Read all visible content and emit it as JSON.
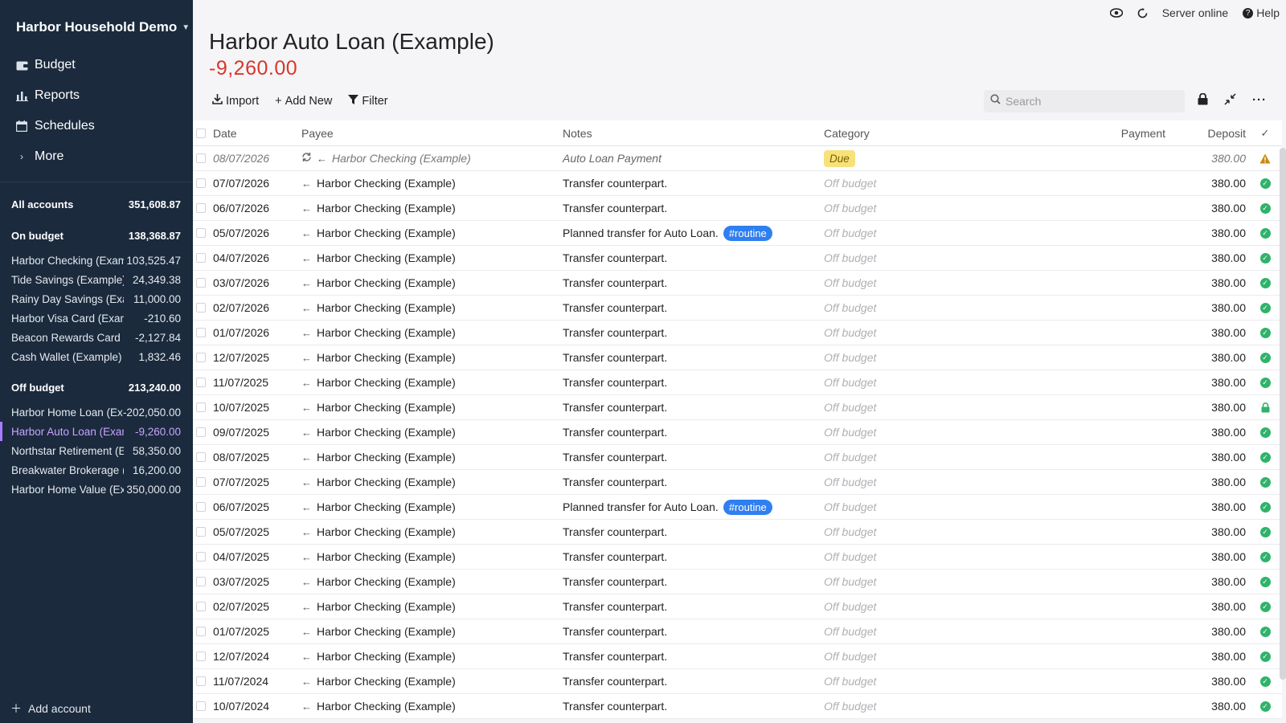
{
  "sidebar": {
    "budget_name": "Harbor Household Demo",
    "nav": [
      {
        "label": "Budget",
        "icon": "wallet-icon"
      },
      {
        "label": "Reports",
        "icon": "bar-chart-icon"
      },
      {
        "label": "Schedules",
        "icon": "calendar-icon"
      },
      {
        "label": "More",
        "icon": "chevron-right-icon"
      }
    ],
    "all_accounts": {
      "label": "All accounts",
      "balance": "351,608.87"
    },
    "on_budget": {
      "label": "On budget",
      "balance": "138,368.87"
    },
    "on_budget_accounts": [
      {
        "name": "Harbor Checking (Example)",
        "balance": "103,525.47"
      },
      {
        "name": "Tide Savings (Example)",
        "balance": "24,349.38"
      },
      {
        "name": "Rainy Day Savings (Example)",
        "balance": "11,000.00"
      },
      {
        "name": "Harbor Visa Card (Example)",
        "balance": "-210.60"
      },
      {
        "name": "Beacon Rewards Card (Example)",
        "balance": "-2,127.84"
      },
      {
        "name": "Cash Wallet (Example)",
        "balance": "1,832.46"
      }
    ],
    "off_budget": {
      "label": "Off budget",
      "balance": "213,240.00"
    },
    "off_budget_accounts": [
      {
        "name": "Harbor Home Loan (Example)",
        "balance": "-202,050.00"
      },
      {
        "name": "Harbor Auto Loan (Example)",
        "balance": "-9,260.00",
        "selected": true
      },
      {
        "name": "Northstar Retirement (Example)",
        "balance": "58,350.00"
      },
      {
        "name": "Breakwater Brokerage (Example)",
        "balance": "16,200.00"
      },
      {
        "name": "Harbor Home Value (Example)",
        "balance": "350,000.00"
      }
    ],
    "add_account": "Add account"
  },
  "topbar": {
    "server_status": "Server online",
    "help": "Help"
  },
  "account": {
    "title": "Harbor Auto Loan (Example)",
    "balance": "-9,260.00"
  },
  "toolbar": {
    "import": "Import",
    "add_new": "Add New",
    "filter": "Filter",
    "search_placeholder": "Search"
  },
  "columns": {
    "date": "Date",
    "payee": "Payee",
    "notes": "Notes",
    "category": "Category",
    "payment": "Payment",
    "deposit": "Deposit"
  },
  "colors": {
    "sidebar_bg": "#1b2a3d",
    "negative": "#d9362b",
    "selected_account": "#c8a5ff",
    "tag": "#2f7ff0",
    "cleared": "#2fb36a"
  },
  "transactions": [
    {
      "date": "08/07/2026",
      "payee": "Harbor Checking (Example)",
      "notes": "Auto Loan Payment",
      "tag": "",
      "category": "Due",
      "payment": "",
      "deposit": "380.00",
      "status": "warning",
      "scheduled": true
    },
    {
      "date": "07/07/2026",
      "payee": "Harbor Checking (Example)",
      "notes": "Transfer counterpart.",
      "tag": "",
      "category": "Off budget",
      "payment": "",
      "deposit": "380.00",
      "status": "cleared"
    },
    {
      "date": "06/07/2026",
      "payee": "Harbor Checking (Example)",
      "notes": "Transfer counterpart.",
      "tag": "",
      "category": "Off budget",
      "payment": "",
      "deposit": "380.00",
      "status": "cleared"
    },
    {
      "date": "05/07/2026",
      "payee": "Harbor Checking (Example)",
      "notes": "Planned transfer for Auto Loan.",
      "tag": "#routine",
      "category": "Off budget",
      "payment": "",
      "deposit": "380.00",
      "status": "cleared"
    },
    {
      "date": "04/07/2026",
      "payee": "Harbor Checking (Example)",
      "notes": "Transfer counterpart.",
      "tag": "",
      "category": "Off budget",
      "payment": "",
      "deposit": "380.00",
      "status": "cleared"
    },
    {
      "date": "03/07/2026",
      "payee": "Harbor Checking (Example)",
      "notes": "Transfer counterpart.",
      "tag": "",
      "category": "Off budget",
      "payment": "",
      "deposit": "380.00",
      "status": "cleared"
    },
    {
      "date": "02/07/2026",
      "payee": "Harbor Checking (Example)",
      "notes": "Transfer counterpart.",
      "tag": "",
      "category": "Off budget",
      "payment": "",
      "deposit": "380.00",
      "status": "cleared"
    },
    {
      "date": "01/07/2026",
      "payee": "Harbor Checking (Example)",
      "notes": "Transfer counterpart.",
      "tag": "",
      "category": "Off budget",
      "payment": "",
      "deposit": "380.00",
      "status": "cleared"
    },
    {
      "date": "12/07/2025",
      "payee": "Harbor Checking (Example)",
      "notes": "Transfer counterpart.",
      "tag": "",
      "category": "Off budget",
      "payment": "",
      "deposit": "380.00",
      "status": "cleared"
    },
    {
      "date": "11/07/2025",
      "payee": "Harbor Checking (Example)",
      "notes": "Transfer counterpart.",
      "tag": "",
      "category": "Off budget",
      "payment": "",
      "deposit": "380.00",
      "status": "cleared"
    },
    {
      "date": "10/07/2025",
      "payee": "Harbor Checking (Example)",
      "notes": "Transfer counterpart.",
      "tag": "",
      "category": "Off budget",
      "payment": "",
      "deposit": "380.00",
      "status": "locked"
    },
    {
      "date": "09/07/2025",
      "payee": "Harbor Checking (Example)",
      "notes": "Transfer counterpart.",
      "tag": "",
      "category": "Off budget",
      "payment": "",
      "deposit": "380.00",
      "status": "cleared"
    },
    {
      "date": "08/07/2025",
      "payee": "Harbor Checking (Example)",
      "notes": "Transfer counterpart.",
      "tag": "",
      "category": "Off budget",
      "payment": "",
      "deposit": "380.00",
      "status": "cleared"
    },
    {
      "date": "07/07/2025",
      "payee": "Harbor Checking (Example)",
      "notes": "Transfer counterpart.",
      "tag": "",
      "category": "Off budget",
      "payment": "",
      "deposit": "380.00",
      "status": "cleared"
    },
    {
      "date": "06/07/2025",
      "payee": "Harbor Checking (Example)",
      "notes": "Planned transfer for Auto Loan.",
      "tag": "#routine",
      "category": "Off budget",
      "payment": "",
      "deposit": "380.00",
      "status": "cleared"
    },
    {
      "date": "05/07/2025",
      "payee": "Harbor Checking (Example)",
      "notes": "Transfer counterpart.",
      "tag": "",
      "category": "Off budget",
      "payment": "",
      "deposit": "380.00",
      "status": "cleared"
    },
    {
      "date": "04/07/2025",
      "payee": "Harbor Checking (Example)",
      "notes": "Transfer counterpart.",
      "tag": "",
      "category": "Off budget",
      "payment": "",
      "deposit": "380.00",
      "status": "cleared"
    },
    {
      "date": "03/07/2025",
      "payee": "Harbor Checking (Example)",
      "notes": "Transfer counterpart.",
      "tag": "",
      "category": "Off budget",
      "payment": "",
      "deposit": "380.00",
      "status": "cleared"
    },
    {
      "date": "02/07/2025",
      "payee": "Harbor Checking (Example)",
      "notes": "Transfer counterpart.",
      "tag": "",
      "category": "Off budget",
      "payment": "",
      "deposit": "380.00",
      "status": "cleared"
    },
    {
      "date": "01/07/2025",
      "payee": "Harbor Checking (Example)",
      "notes": "Transfer counterpart.",
      "tag": "",
      "category": "Off budget",
      "payment": "",
      "deposit": "380.00",
      "status": "cleared"
    },
    {
      "date": "12/07/2024",
      "payee": "Harbor Checking (Example)",
      "notes": "Transfer counterpart.",
      "tag": "",
      "category": "Off budget",
      "payment": "",
      "deposit": "380.00",
      "status": "cleared"
    },
    {
      "date": "11/07/2024",
      "payee": "Harbor Checking (Example)",
      "notes": "Transfer counterpart.",
      "tag": "",
      "category": "Off budget",
      "payment": "",
      "deposit": "380.00",
      "status": "cleared"
    },
    {
      "date": "10/07/2024",
      "payee": "Harbor Checking (Example)",
      "notes": "Transfer counterpart.",
      "tag": "",
      "category": "Off budget",
      "payment": "",
      "deposit": "380.00",
      "status": "cleared"
    }
  ]
}
